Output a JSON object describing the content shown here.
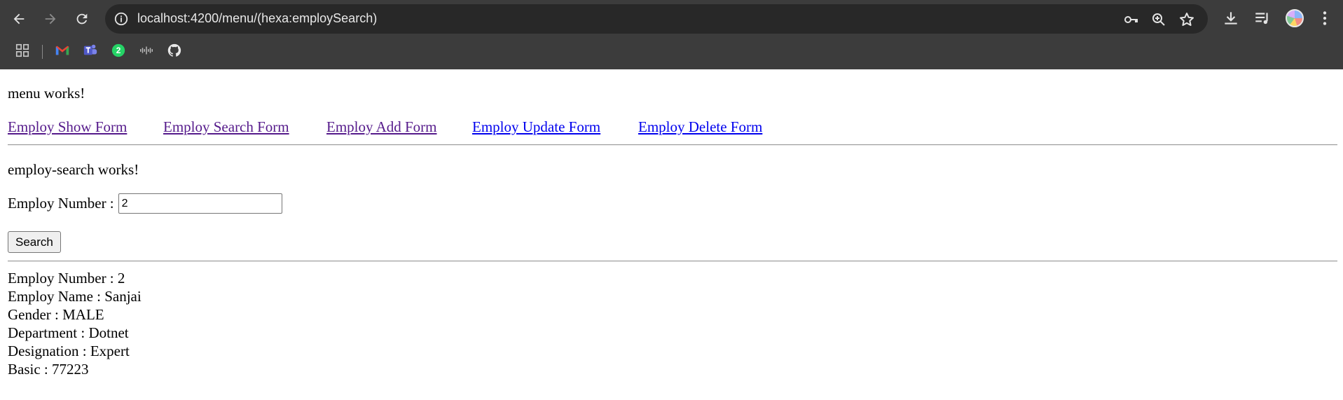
{
  "browser": {
    "url": "localhost:4200/menu/(hexa:employSearch)",
    "bookmark_badge": "2"
  },
  "menu": {
    "title": "menu works!",
    "links": [
      {
        "label": "Employ Show Form"
      },
      {
        "label": "Employ Search Form"
      },
      {
        "label": "Employ Add Form"
      },
      {
        "label": "Employ Update Form"
      },
      {
        "label": "Employ Delete Form"
      }
    ]
  },
  "search": {
    "title": "employ-search works!",
    "field_label": "Employ Number :",
    "field_value": "2",
    "button_label": "Search"
  },
  "result": [
    "Employ Number : 2",
    "Employ Name : Sanjai",
    "Gender : MALE",
    "Department : Dotnet",
    "Designation : Expert",
    "Basic : 77223"
  ]
}
